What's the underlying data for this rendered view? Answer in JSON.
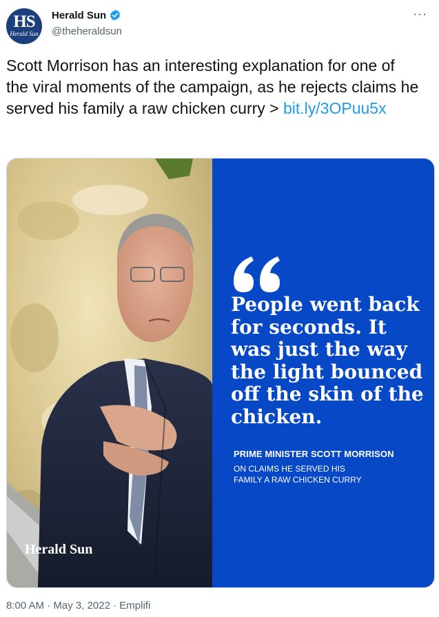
{
  "account": {
    "name": "Herald Sun",
    "handle": "@theheraldsun",
    "avatar_text": "HS",
    "avatar_subtext": "Herald Sun",
    "verified": true
  },
  "more_icon": "more-horizontal-icon",
  "tweet": {
    "text": "Scott Morrison has an interesting explanation for one of the viral moments of the campaign, as he rejects claims he served his family a raw chicken curry >",
    "link": "bit.ly/3OPuu5x"
  },
  "media": {
    "quote": "People went back for seconds. It was just the way the light bounced off the skin of the chicken.",
    "attribution": "PRIME MINISTER SCOTT MORRISON",
    "attribution_sub_1": "ON CLAIMS HE SERVED HIS",
    "attribution_sub_2": "FAMILY A RAW CHICKEN CURRY",
    "watermark": "Herald Sun",
    "panel_color": "#0748c7"
  },
  "meta": {
    "time": "8:00 AM",
    "sep1": "·",
    "date": "May 3, 2022",
    "sep2": "·",
    "source": "Emplifi"
  },
  "colors": {
    "link": "#1d9bf0",
    "secondary_text": "#536471",
    "verified": "#1d9bf0"
  }
}
